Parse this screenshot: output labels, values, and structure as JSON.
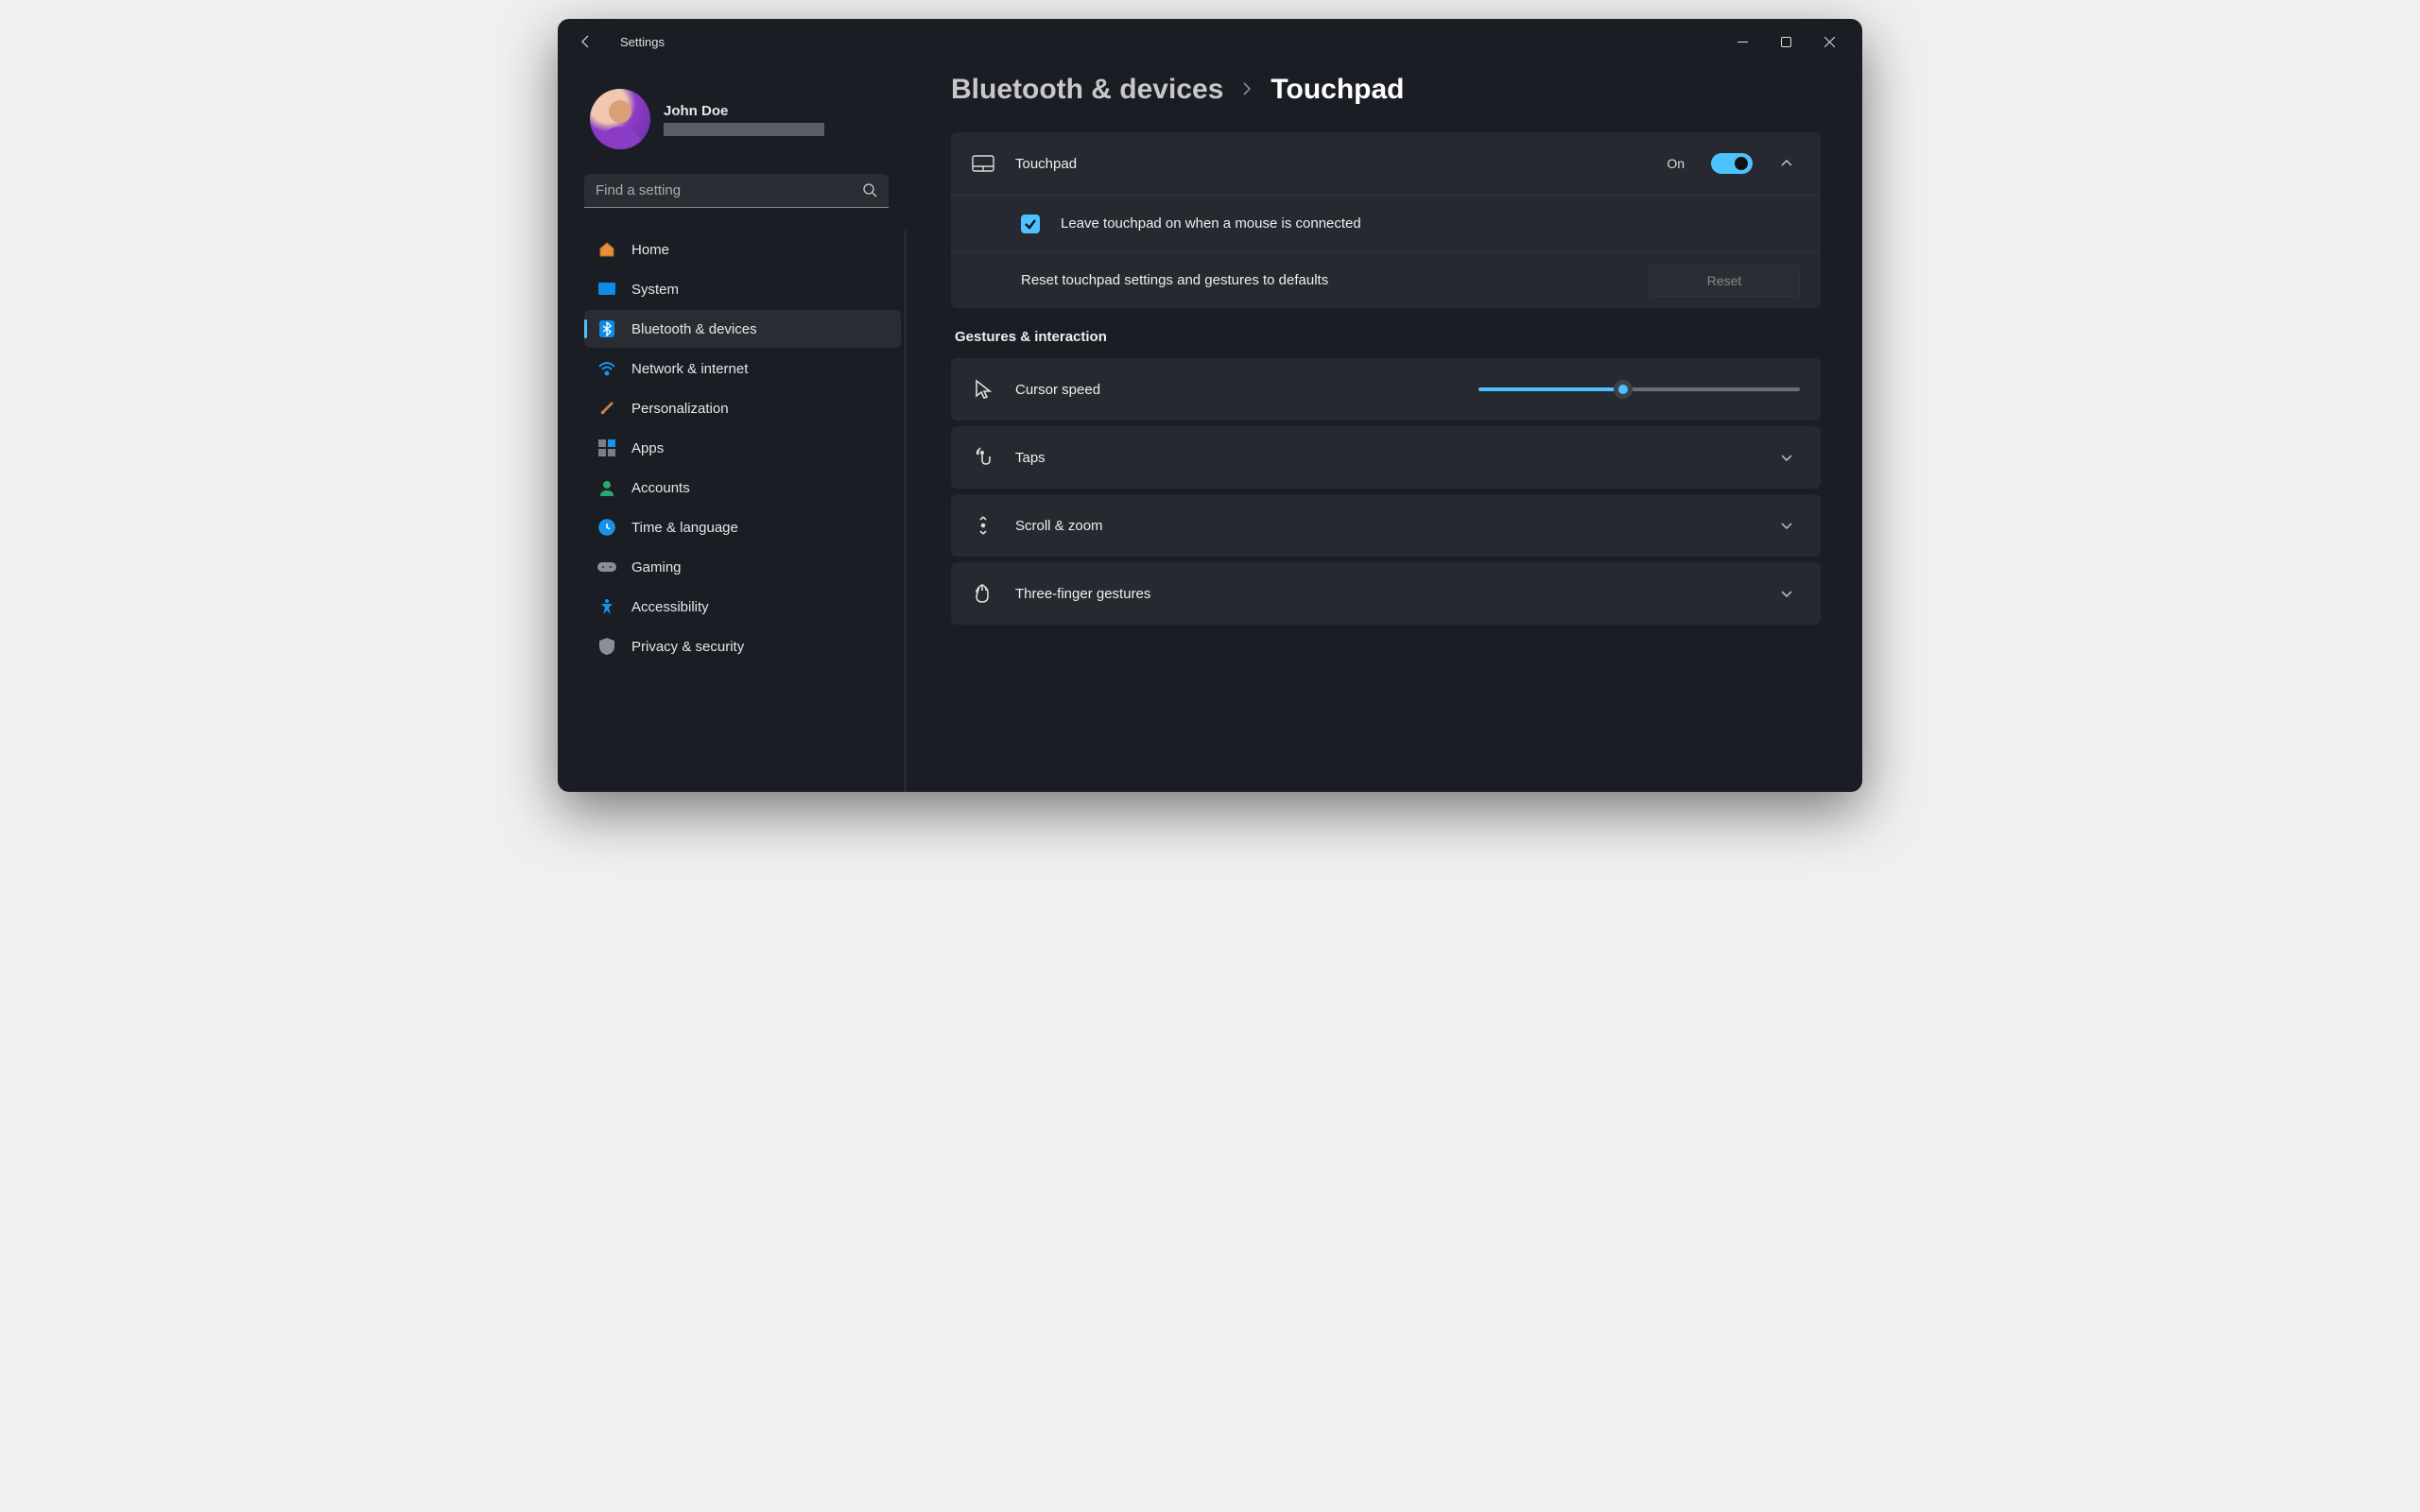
{
  "title": "Settings",
  "user": {
    "name": "John Doe"
  },
  "search": {
    "placeholder": "Find a setting"
  },
  "nav": {
    "items": [
      {
        "label": "Home"
      },
      {
        "label": "System"
      },
      {
        "label": "Bluetooth & devices"
      },
      {
        "label": "Network & internet"
      },
      {
        "label": "Personalization"
      },
      {
        "label": "Apps"
      },
      {
        "label": "Accounts"
      },
      {
        "label": "Time & language"
      },
      {
        "label": "Gaming"
      },
      {
        "label": "Accessibility"
      },
      {
        "label": "Privacy & security"
      }
    ],
    "active_index": 2
  },
  "breadcrumb": {
    "parent": "Bluetooth & devices",
    "current": "Touchpad"
  },
  "touchpad": {
    "label": "Touchpad",
    "state_text": "On",
    "leave_on_label": "Leave touchpad on when a mouse is connected",
    "reset_label": "Reset touchpad settings and gestures to defaults",
    "reset_button": "Reset"
  },
  "section": {
    "gestures_title": "Gestures & interaction"
  },
  "gestures": {
    "cursor_speed_label": "Cursor speed",
    "cursor_speed_percent": 45,
    "taps_label": "Taps",
    "scroll_label": "Scroll & zoom",
    "threefinger_label": "Three-finger gestures"
  },
  "colors": {
    "accent": "#4cc2ff"
  }
}
